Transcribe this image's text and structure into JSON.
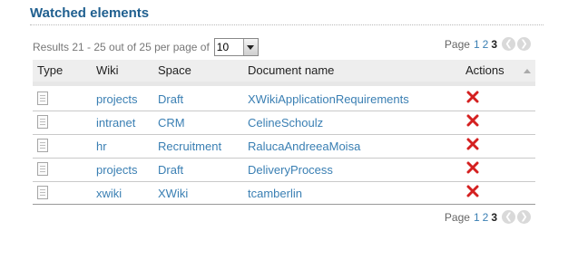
{
  "title": "Watched elements",
  "results_text": "Results 21 - 25 out of 25 per page of",
  "per_page_value": "10",
  "pagination": {
    "label": "Page",
    "pages": [
      "1",
      "2",
      "3"
    ],
    "current": "3"
  },
  "columns": {
    "type": "Type",
    "wiki": "Wiki",
    "space": "Space",
    "document": "Document name",
    "actions": "Actions"
  },
  "rows": [
    {
      "wiki": "projects",
      "space": "Draft",
      "document": "XWikiApplicationRequirements"
    },
    {
      "wiki": "intranet",
      "space": "CRM",
      "document": "CelineSchoulz"
    },
    {
      "wiki": "hr",
      "space": "Recruitment",
      "document": "RalucaAndreeaMoisa"
    },
    {
      "wiki": "projects",
      "space": "Draft",
      "document": "DeliveryProcess"
    },
    {
      "wiki": "xwiki",
      "space": "XWiki",
      "document": "tcamberlin"
    }
  ],
  "icons": {
    "type": "document-icon",
    "action": "delete-icon",
    "sort": "sort-ascending-icon",
    "prev": "previous-page-icon",
    "next": "next-page-icon"
  },
  "colors": {
    "title": "#1f5f8f",
    "link": "#3a7fb3",
    "delete": "#d42020",
    "header_bg": "#eeeeee"
  }
}
